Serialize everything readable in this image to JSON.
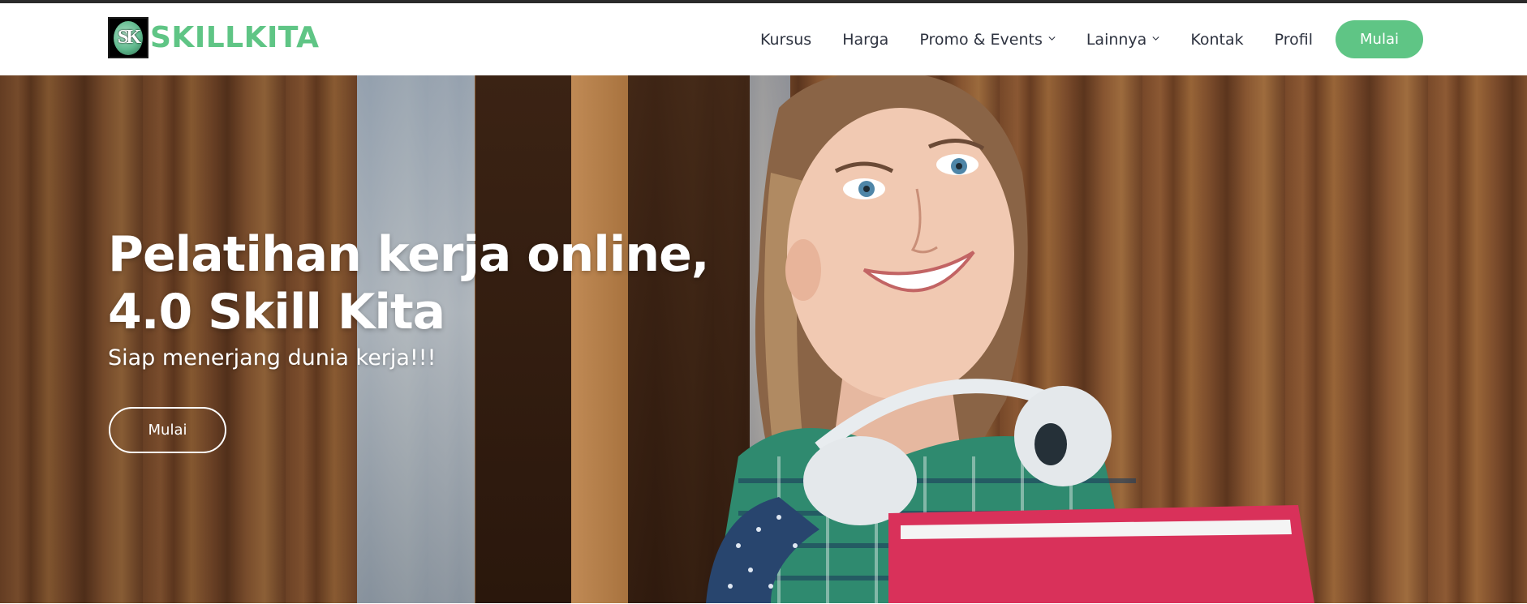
{
  "brand": {
    "logo_text": "SK",
    "name": "SKILLKITA",
    "accent_color": "#5fc585"
  },
  "nav": {
    "items": [
      {
        "label": "Kursus"
      },
      {
        "label": "Harga"
      },
      {
        "label": "Promo & Events",
        "icon": "chevron-down-icon"
      },
      {
        "label": "Lainnya",
        "icon": "chevron-down-icon"
      },
      {
        "label": "Kontak"
      },
      {
        "label": "Profil"
      }
    ],
    "cta_label": "Mulai"
  },
  "hero": {
    "title_line1": "Pelatihan kerja online,",
    "title_line2": "4.0 Skill Kita",
    "subtitle": "Siap menerjang dunia kerja!!!",
    "button_label": "Mulai",
    "image": "student-with-headphones-and-folder"
  }
}
